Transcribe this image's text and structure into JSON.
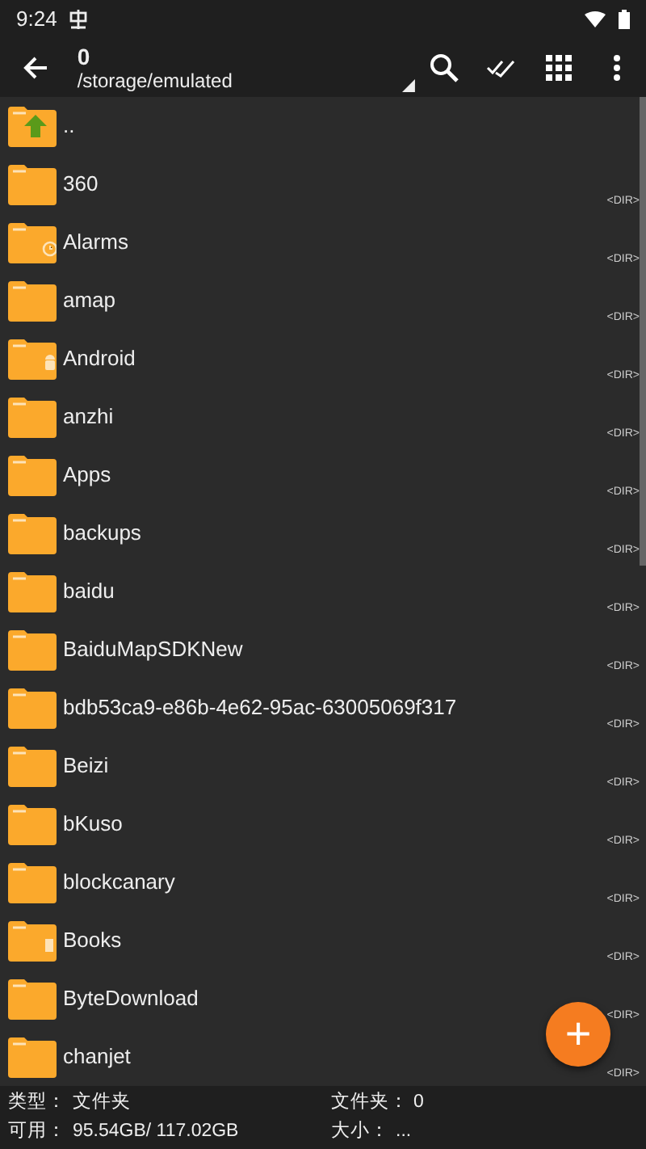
{
  "status_bar": {
    "time": "9:24"
  },
  "toolbar": {
    "title": "0",
    "path": "/storage/emulated"
  },
  "files": [
    {
      "name": "..",
      "kind": "up"
    },
    {
      "name": "360",
      "kind": "plain",
      "type": "<DIR>"
    },
    {
      "name": "Alarms",
      "kind": "alarm",
      "type": "<DIR>"
    },
    {
      "name": "amap",
      "kind": "plain",
      "type": "<DIR>"
    },
    {
      "name": "Android",
      "kind": "android",
      "type": "<DIR>"
    },
    {
      "name": "anzhi",
      "kind": "plain",
      "type": "<DIR>"
    },
    {
      "name": "Apps",
      "kind": "plain",
      "type": "<DIR>"
    },
    {
      "name": "backups",
      "kind": "plain",
      "type": "<DIR>"
    },
    {
      "name": "baidu",
      "kind": "plain",
      "type": "<DIR>"
    },
    {
      "name": "BaiduMapSDKNew",
      "kind": "plain",
      "type": "<DIR>"
    },
    {
      "name": "bdb53ca9-e86b-4e62-95ac-63005069f317",
      "kind": "plain",
      "type": "<DIR>"
    },
    {
      "name": "Beizi",
      "kind": "plain",
      "type": "<DIR>"
    },
    {
      "name": "bKuso",
      "kind": "plain",
      "type": "<DIR>"
    },
    {
      "name": "blockcanary",
      "kind": "plain",
      "type": "<DIR>"
    },
    {
      "name": "Books",
      "kind": "book",
      "type": "<DIR>"
    },
    {
      "name": "ByteDownload",
      "kind": "plain",
      "type": "<DIR>"
    },
    {
      "name": "chanjet",
      "kind": "plain",
      "type": "<DIR>"
    }
  ],
  "fab": {
    "label": "+"
  },
  "info": [
    {
      "label": "类型：",
      "value": "文件夹"
    },
    {
      "label": "文件夹：",
      "value": "0"
    },
    {
      "label": "可用：",
      "value": "95.54GB/ 117.02GB"
    },
    {
      "label": "大小：",
      "value": "..."
    }
  ]
}
